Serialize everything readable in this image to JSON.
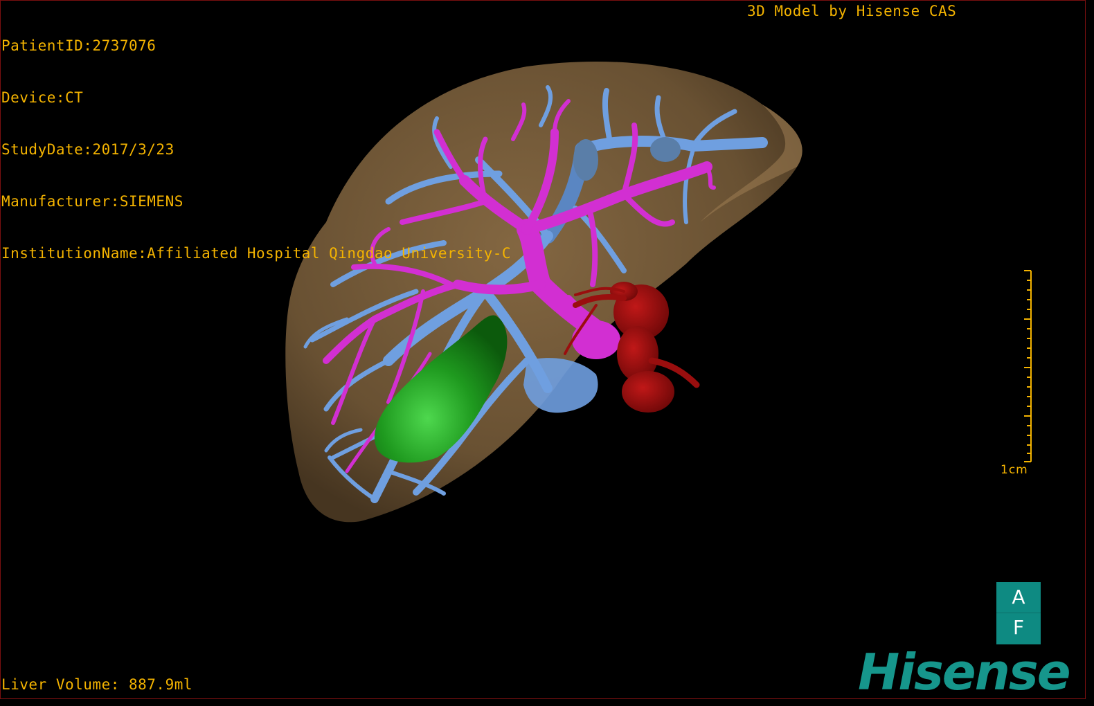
{
  "header": {
    "patient_id": "PatientID:2737076",
    "device": "Device:CT",
    "study_date": "StudyDate:2017/3/23",
    "manufacturer": "Manufacturer:SIEMENS",
    "institution": "InstitutionName:Affiliated Hospital Qingdao University-C",
    "model_credit": "3D Model by Hisense CAS"
  },
  "footer": {
    "liver_volume": "Liver Volume: 887.9ml"
  },
  "scale": {
    "label": "1cm"
  },
  "orientation": {
    "top": "A",
    "bottom": "F"
  },
  "brand": {
    "logo_text": "Hisense"
  },
  "colors": {
    "overlay_text": "#f5b400",
    "liver": "#7a5f3c",
    "portal_vein": "#d22fd2",
    "hepatic_vein": "#6f9fe0",
    "gallbladder": "#1f9a1f",
    "artery": "#9a0e0e",
    "brand": "#16968c"
  }
}
